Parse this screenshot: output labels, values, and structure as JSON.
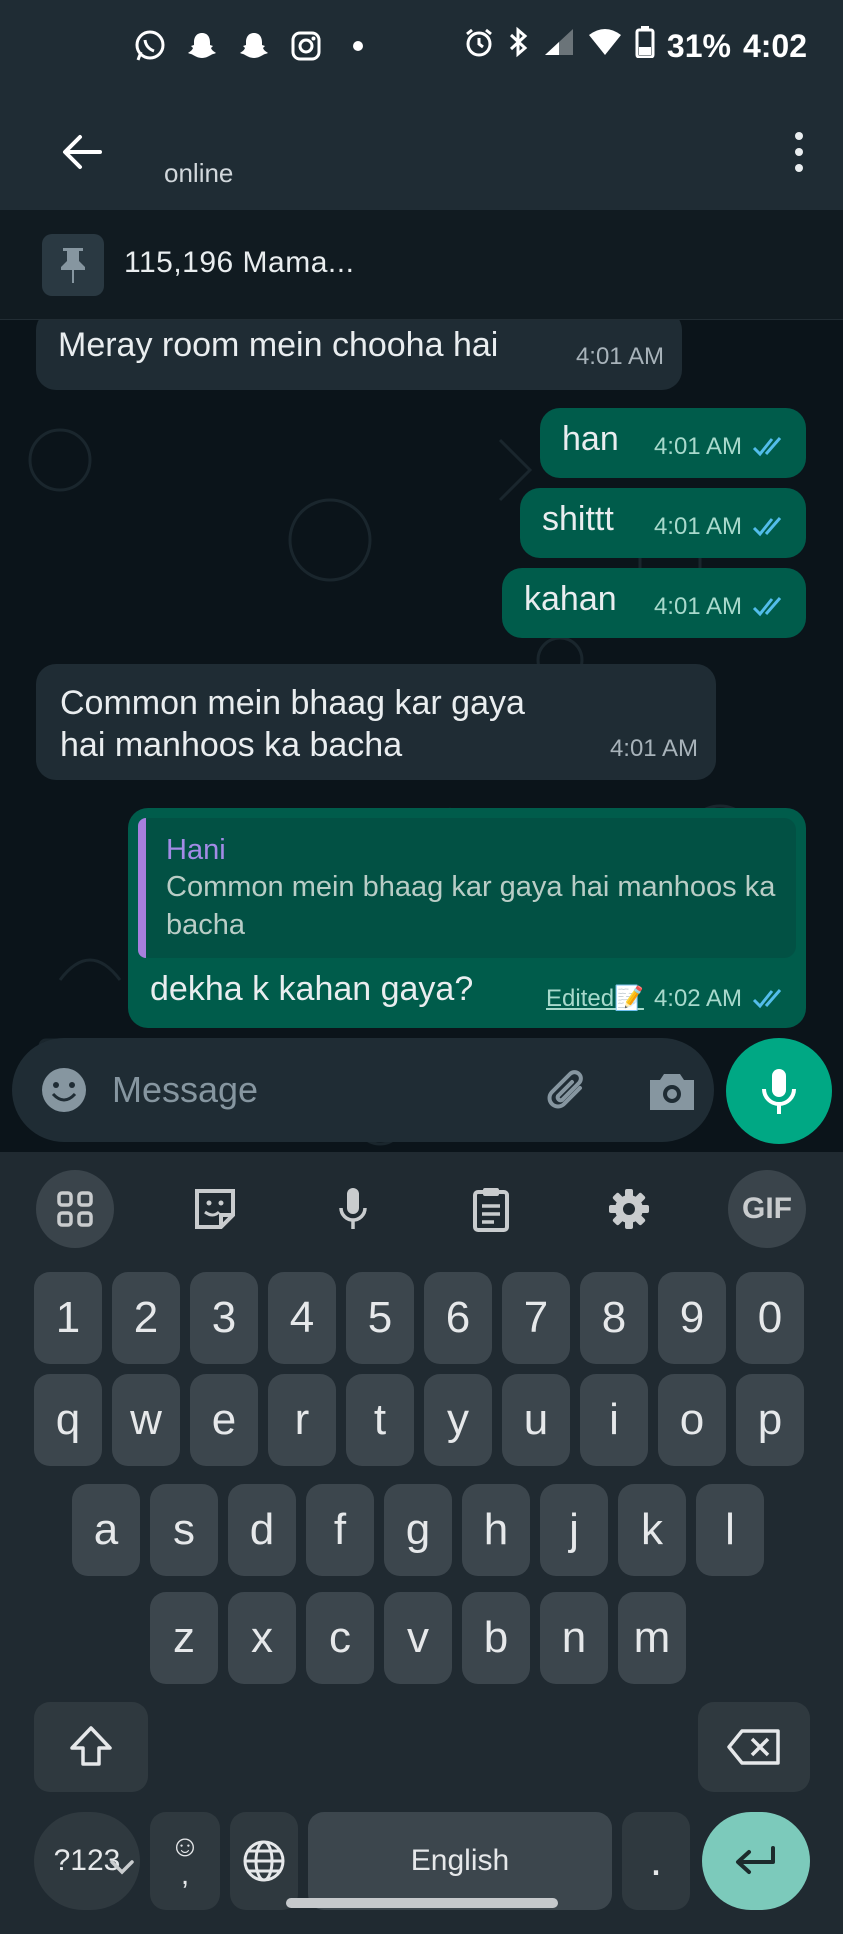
{
  "status_bar": {
    "battery": "31%",
    "time": "4:02",
    "left_icons": [
      "whatsapp-icon",
      "snapchat-icon",
      "snapchat-icon",
      "instagram-icon",
      "dot-icon"
    ],
    "right_icons": [
      "alarm-icon",
      "bluetooth-icon",
      "signal-icon",
      "wifi-icon",
      "battery-icon"
    ]
  },
  "header": {
    "status": "online"
  },
  "pinned": {
    "text": "115,196 Mama..."
  },
  "messages": [
    {
      "direction": "in",
      "text": "Meray room mein chooha hai",
      "time": "4:01 AM"
    },
    {
      "direction": "out",
      "text": "han",
      "time": "4:01 AM",
      "read": true
    },
    {
      "direction": "out",
      "text": "shittt",
      "time": "4:01 AM",
      "read": true
    },
    {
      "direction": "out",
      "text": "kahan",
      "time": "4:01 AM",
      "read": true
    },
    {
      "direction": "in",
      "text": "Common mein bhaag kar gaya hai manhoos ka bacha",
      "time": "4:01 AM"
    },
    {
      "direction": "out",
      "text": "dekha k kahan gaya?",
      "time": "4:02 AM",
      "read": true,
      "edited": "Edited📝",
      "quote": {
        "name": "Hani",
        "text": "Common mein bhaag kar gaya hai manhoos ka bacha"
      }
    }
  ],
  "composer": {
    "placeholder": "Message"
  },
  "colors": {
    "incoming_bubble": "#1f2c34",
    "outgoing_bubble": "#005c4b",
    "accent": "#00a884",
    "read_ticks": "#53bdeb"
  },
  "keyboard": {
    "toolbar": [
      "apps-icon",
      "sticker-icon",
      "voice-icon",
      "clipboard-icon",
      "settings-icon",
      "GIF"
    ],
    "number_row": [
      "1",
      "2",
      "3",
      "4",
      "5",
      "6",
      "7",
      "8",
      "9",
      "0"
    ],
    "row1": [
      "q",
      "w",
      "e",
      "r",
      "t",
      "y",
      "u",
      "i",
      "o",
      "p"
    ],
    "row2": [
      "a",
      "s",
      "d",
      "f",
      "g",
      "h",
      "j",
      "k",
      "l"
    ],
    "row3": [
      "z",
      "x",
      "c",
      "v",
      "b",
      "n",
      "m"
    ],
    "symbols_key": "?123",
    "comma_key": ",",
    "space_label": "English",
    "period_key": "."
  }
}
